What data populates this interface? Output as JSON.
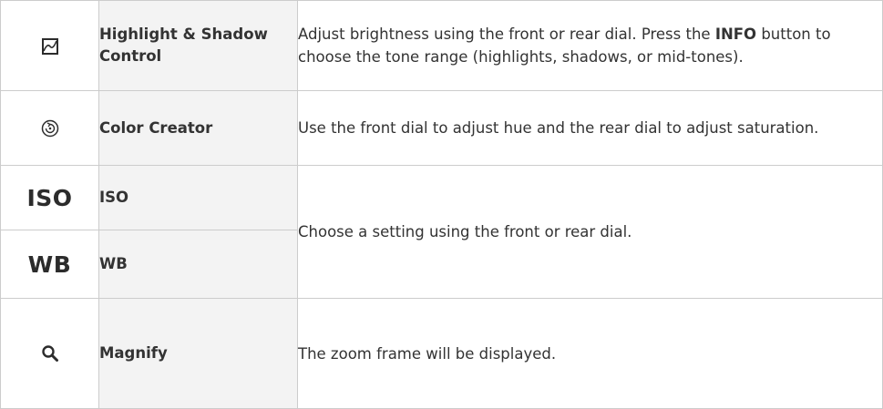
{
  "rows": [
    {
      "icon": "highlight-shadow-icon",
      "label": "Highlight & Shadow Control",
      "desc_parts": [
        "Adjust brightness using the front or rear dial. Press the ",
        "INFO",
        " button to choose the tone range (highlights, shadows, or mid-tones)."
      ]
    },
    {
      "icon": "color-creator-icon",
      "label": "Color Creator",
      "desc": "Use the front dial to adjust hue and the rear dial to adjust saturation."
    },
    {
      "icon_text": "ISO",
      "label": "ISO"
    },
    {
      "icon_text": "WB",
      "label": "WB"
    },
    {
      "icon": "magnify-icon",
      "label": "Magnify",
      "desc": "The zoom frame will be displayed."
    }
  ],
  "shared_desc_iso_wb": "Choose a setting using the front or rear dial."
}
